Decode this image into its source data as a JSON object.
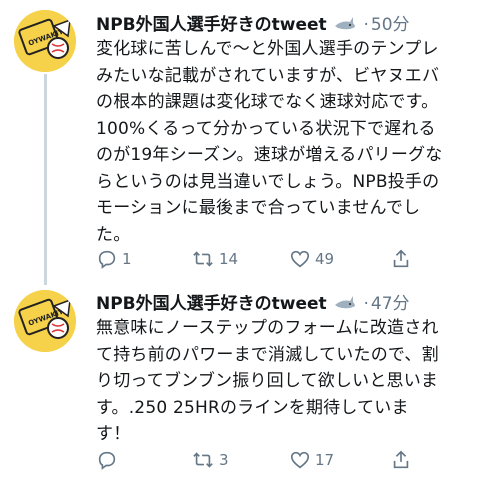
{
  "tweets": [
    {
      "author": "NPB外国人選手好きのtweet",
      "separator": "·",
      "time": "50分",
      "text": "変化球に苦しんで〜と外国人選手のテンプレ\nみたいな記載がされていますが、ビヤヌエバ\nの根本的課題は変化球でなく速球対応です。\n100%くるって分かっている状況下で遅れる\nのが19年シーズン。速球が増えるパリーグな\nらというのは見当違いでしょう。NPB投手の\nモーションに最後まで合っていませんでし\nた。",
      "replies": "1",
      "retweets": "14",
      "likes": "49"
    },
    {
      "author": "NPB外国人選手好きのtweet",
      "separator": "·",
      "time": "47分",
      "text": "無意味にノーステップのフォームに改造され\nて持ち前のパワーまで消滅していたので、割\nり切ってブンブン振り回して欲しいと思いま\nす。.250 25HRのラインを期待していま\nす！",
      "replies": "",
      "retweets": "3",
      "likes": "17"
    }
  ],
  "avatar_text": "OYWAKIYT",
  "icons": [
    "avatar-icon",
    "shark-emoji-icon",
    "reply-icon",
    "retweet-icon",
    "like-icon",
    "share-icon"
  ],
  "colors": {
    "avatar_bg": "#f6d14a",
    "muted": "#657786",
    "thread_line": "#ccd6dd",
    "divider": "#e6ecf0"
  }
}
